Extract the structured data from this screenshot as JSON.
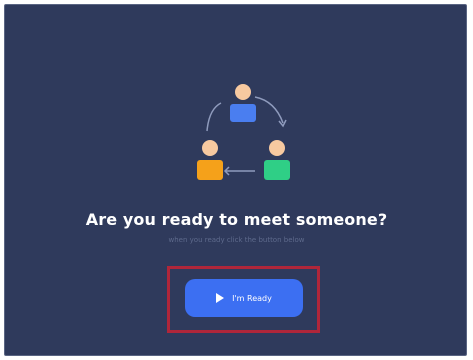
{
  "dialog": {
    "headline": "Are you ready to meet someone?",
    "subtext": "when you ready click the button below",
    "ready_button_label": "I'm Ready",
    "icons": {
      "illustration": "people-matching-icon",
      "play": "play-icon"
    }
  },
  "colors": {
    "background": "#2f3a5c",
    "primary_button": "#3c6ff2",
    "highlight": "#b0263a",
    "person_blue": "#4a7ef0",
    "person_orange": "#f5a11a",
    "person_green": "#2fcf86",
    "skin": "#f7c9a0"
  }
}
